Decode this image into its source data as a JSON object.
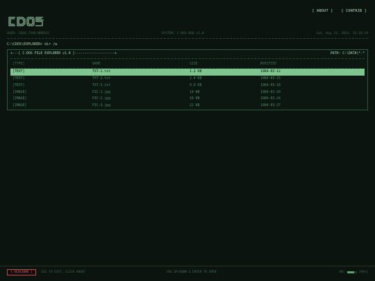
{
  "header": {
    "logo_text": "CDOS",
    "nav": [
      {
        "label": "[ ABOUT ]"
      },
      {
        "label": "[ CONTRIB ]"
      }
    ]
  },
  "status": {
    "left": "USER: CDOS-7SH0-NRDEGS",
    "center": "SYSTEM: C-DOS BSD v2.0",
    "right": "Sat, Aug 21, 2024, 15:18:19"
  },
  "command": "C:\\CDOS\\EXPLORER> dir /w",
  "panel": {
    "title": "+---[ C-DOS FILE EXPLORER v1.0 ]--------------------+",
    "path": "PATH: C:\\DATA\\*.*"
  },
  "table": {
    "headers": {
      "type": "[TYPE]",
      "name": "NAME",
      "size": "SIZE",
      "modified": "MODIFIED"
    },
    "rows": [
      {
        "type": "[TEXT]",
        "name": "TXT-1.txt",
        "size": "1.2 KB",
        "modified": "1984-03-12",
        "selected": true
      },
      {
        "type": "[TEXT]",
        "name": "TXT-2.txt",
        "size": "2.4 KB",
        "modified": "1984-03-15",
        "selected": false
      },
      {
        "type": "[TEXT]",
        "name": "TXT-3.txt",
        "size": "0.9 KB",
        "modified": "1984-03-18",
        "selected": false
      },
      {
        "type": "[IMAGE]",
        "name": "PIC-1.jpg",
        "size": "14 KB",
        "modified": "1984-03-20",
        "selected": false
      },
      {
        "type": "[IMAGE]",
        "name": "PIC-2.jpg",
        "size": "18 KB",
        "modified": "1984-03-24",
        "selected": false
      },
      {
        "type": "[IMAGE]",
        "name": "PIC-3.jpg",
        "size": "22 KB",
        "modified": "1984-03-27",
        "selected": false
      }
    ]
  },
  "footer": {
    "sessions_label": "[ SESSIONS ]",
    "tip": "ESC TO EXIT, CLICK ABOUT",
    "center": "USE UP/DOWN & ENTER TO OPEN",
    "right_label": "BR:",
    "right_value": "[96%]",
    "meter_level": 0.72
  },
  "colors": {
    "background": "#0b140f",
    "primary": "#7fbf8e",
    "selected_row": "#7fc590",
    "accent_red": "#c14a4a"
  }
}
